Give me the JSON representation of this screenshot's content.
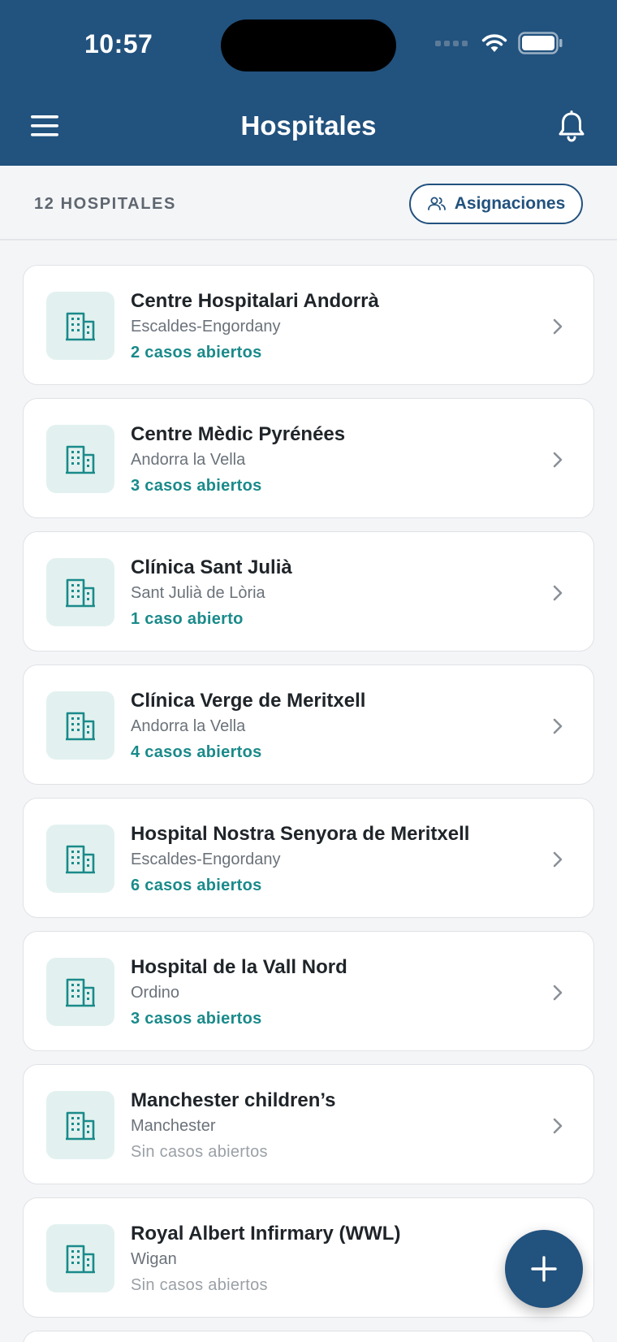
{
  "status_bar": {
    "time": "10:57"
  },
  "nav": {
    "title": "Hospitales"
  },
  "subbar": {
    "count_label": "12 HOSPITALES",
    "assign_label": "Asignaciones"
  },
  "hospitals": [
    {
      "name": "Centre Hospitalari Andorrà",
      "city": "Escaldes-Engordany",
      "cases": "2 casos abiertos",
      "has_cases": true
    },
    {
      "name": "Centre Mèdic Pyrénées",
      "city": "Andorra la Vella",
      "cases": "3 casos abiertos",
      "has_cases": true
    },
    {
      "name": "Clínica Sant Julià",
      "city": "Sant Julià de Lòria",
      "cases": "1 caso abierto",
      "has_cases": true
    },
    {
      "name": "Clínica Verge de Meritxell",
      "city": "Andorra la Vella",
      "cases": "4 casos abiertos",
      "has_cases": true
    },
    {
      "name": "Hospital Nostra Senyora de Meritxell",
      "city": "Escaldes-Engordany",
      "cases": "6 casos abiertos",
      "has_cases": true
    },
    {
      "name": "Hospital de la Vall Nord",
      "city": "Ordino",
      "cases": "3 casos abiertos",
      "has_cases": true
    },
    {
      "name": "Manchester children’s",
      "city": "Manchester",
      "cases": "Sin casos abiertos",
      "has_cases": false
    },
    {
      "name": "Royal Albert Infirmary (WWL)",
      "city": "Wigan",
      "cases": "Sin casos abiertos",
      "has_cases": false
    }
  ],
  "icons": {
    "menu": "hamburger-icon",
    "notifications": "bell-icon",
    "assignments": "users-icon",
    "hospital": "building-icon",
    "row_action": "chevron-right-icon",
    "add": "plus-icon"
  },
  "colors": {
    "primary": "#22527e",
    "accent_teal": "#1a8a8a",
    "icon_bg": "#e2f1ef",
    "muted": "#9aa0a6"
  }
}
